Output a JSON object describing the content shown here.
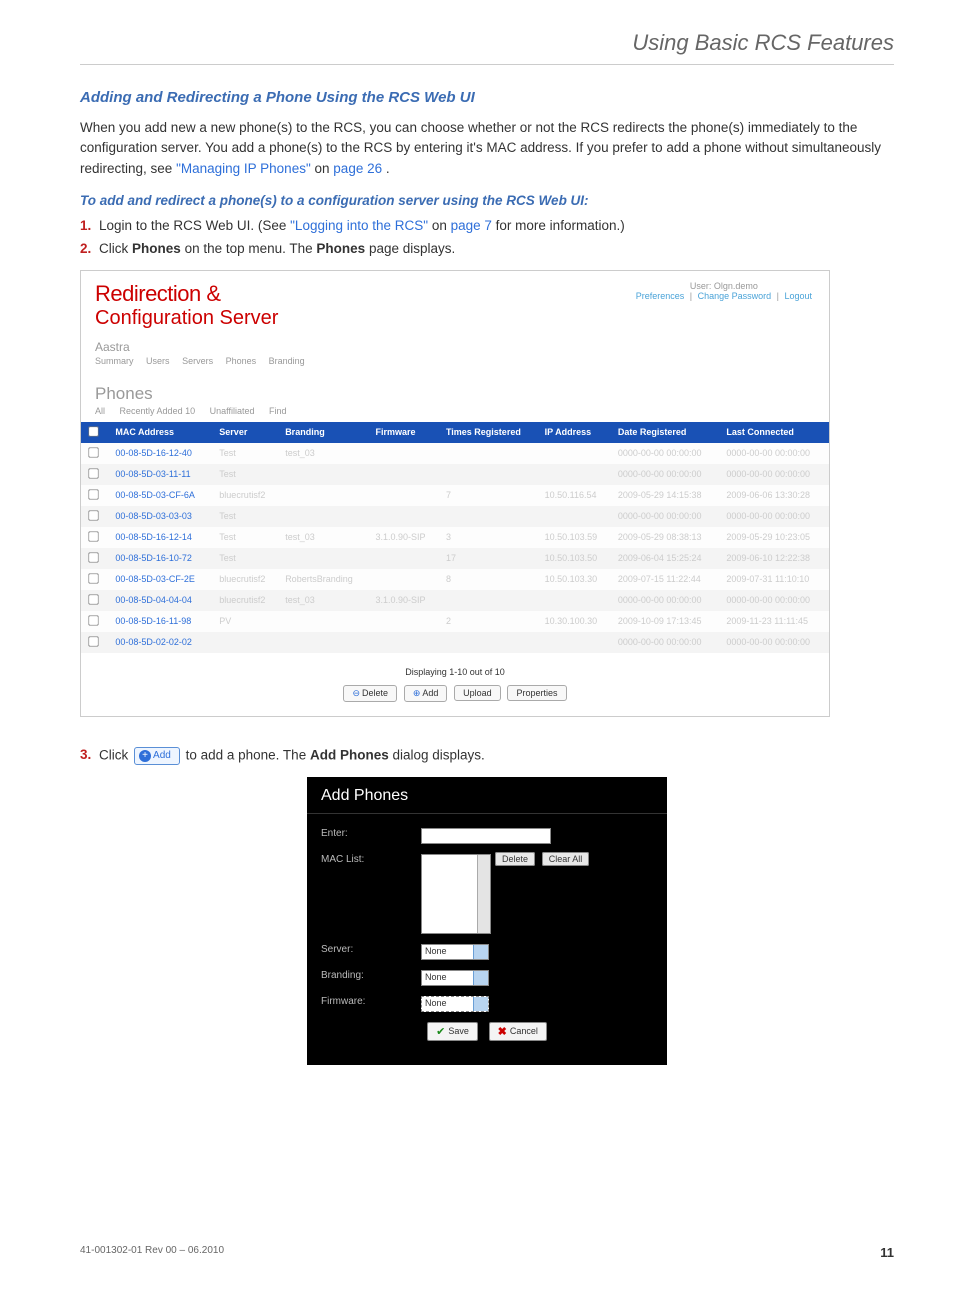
{
  "chapter_title": "Using Basic RCS Features",
  "section_heading": "Adding and Redirecting a Phone Using the RCS Web UI",
  "intro_a": "When you add new a new phone(s) to the RCS, you can choose whether or not the RCS redirects the phone(s) immediately to the configuration server. You add a phone(s) to the RCS by entering it's MAC address. If you prefer to add a phone without simultaneously redirecting, see ",
  "intro_link1": "\"Managing IP Phones\"",
  "intro_b": " on ",
  "intro_link2": "page 26",
  "intro_c": ".",
  "subhead": "To add and redirect a phone(s) to a configuration server using the RCS Web UI:",
  "step1_a": "Login to the RCS Web UI. (See ",
  "step1_link1": "\"Logging into the RCS\"",
  "step1_b": " on ",
  "step1_link2": "page 7",
  "step1_c": " for more information.)",
  "step2_a": "Click ",
  "step2_b": "Phones",
  "step2_c": " on the top menu. The ",
  "step2_d": "Phones",
  "step2_e": " page displays.",
  "step3_a": "Click ",
  "step3_add_label": "Add",
  "step3_b": " to add a phone. The ",
  "step3_c": "Add Phones",
  "step3_d": " dialog displays.",
  "ss1": {
    "logo_a": "Redirection &",
    "logo_b": "Configuration Server",
    "user": "User: Olgn.demo",
    "links": [
      "Preferences",
      "Change Password",
      "Logout"
    ],
    "tenant": "Aastra",
    "nav": [
      "Summary",
      "Users",
      "Servers",
      "Phones",
      "Branding"
    ],
    "pagetitle": "Phones",
    "tabs": [
      "All",
      "Recently Added 10",
      "Unaffiliated",
      "Find"
    ],
    "cols": [
      "MAC Address",
      "Server",
      "Branding",
      "Firmware",
      "Times Registered",
      "IP Address",
      "Date Registered",
      "Last Connected"
    ],
    "rows": [
      {
        "mac": "00-08-5D-16-12-40",
        "server": "Test",
        "branding": "test_03",
        "fw": "",
        "times": "",
        "ip": "",
        "reg": "0000-00-00 00:00:00",
        "last": "0000-00-00 00:00:00"
      },
      {
        "mac": "00-08-5D-03-11-11",
        "server": "Test",
        "branding": "",
        "fw": "",
        "times": "",
        "ip": "",
        "reg": "0000-00-00 00:00:00",
        "last": "0000-00-00 00:00:00"
      },
      {
        "mac": "00-08-5D-03-CF-6A",
        "server": "bluecrutisf2",
        "branding": "",
        "fw": "",
        "times": "7",
        "ip": "10.50.116.54",
        "reg": "2009-05-29 14:15:38",
        "last": "2009-06-06 13:30:28"
      },
      {
        "mac": "00-08-5D-03-03-03",
        "server": "Test",
        "branding": "",
        "fw": "",
        "times": "",
        "ip": "",
        "reg": "0000-00-00 00:00:00",
        "last": "0000-00-00 00:00:00"
      },
      {
        "mac": "00-08-5D-16-12-14",
        "server": "Test",
        "branding": "test_03",
        "fw": "3.1.0.90-SIP",
        "times": "3",
        "ip": "10.50.103.59",
        "reg": "2009-05-29 08:38:13",
        "last": "2009-05-29 10:23:05"
      },
      {
        "mac": "00-08-5D-16-10-72",
        "server": "Test",
        "branding": "",
        "fw": "",
        "times": "17",
        "ip": "10.50.103.50",
        "reg": "2009-06-04 15:25:24",
        "last": "2009-06-10 12:22:38"
      },
      {
        "mac": "00-08-5D-03-CF-2E",
        "server": "bluecrutisf2",
        "branding": "RobertsBranding",
        "fw": "",
        "times": "8",
        "ip": "10.50.103.30",
        "reg": "2009-07-15 11:22:44",
        "last": "2009-07-31 11:10:10"
      },
      {
        "mac": "00-08-5D-04-04-04",
        "server": "bluecrutisf2",
        "branding": "test_03",
        "fw": "3.1.0.90-SIP",
        "times": "",
        "ip": "",
        "reg": "0000-00-00 00:00:00",
        "last": "0000-00-00 00:00:00"
      },
      {
        "mac": "00-08-5D-16-11-98",
        "server": "PV",
        "branding": "",
        "fw": "",
        "times": "2",
        "ip": "10.30.100.30",
        "reg": "2009-10-09 17:13:45",
        "last": "2009-11-23 11:11:45"
      },
      {
        "mac": "00-08-5D-02-02-02",
        "server": "",
        "branding": "",
        "fw": "",
        "times": "",
        "ip": "",
        "reg": "0000-00-00 00:00:00",
        "last": "0000-00-00 00:00:00"
      }
    ],
    "paging": "Displaying 1-10 out of 10",
    "buttons": {
      "delete": "Delete",
      "add": "Add",
      "upload": "Upload",
      "props": "Properties"
    }
  },
  "ss2": {
    "title": "Add Phones",
    "enter": "Enter:",
    "maclist": "MAC List:",
    "delete": "Delete",
    "clearall": "Clear All",
    "server": "Server:",
    "branding": "Branding:",
    "firmware": "Firmware:",
    "none": "None",
    "save": "Save",
    "cancel": "Cancel"
  },
  "footer_left": "41-001302-01 Rev 00 – 06.2010",
  "footer_right": "11"
}
